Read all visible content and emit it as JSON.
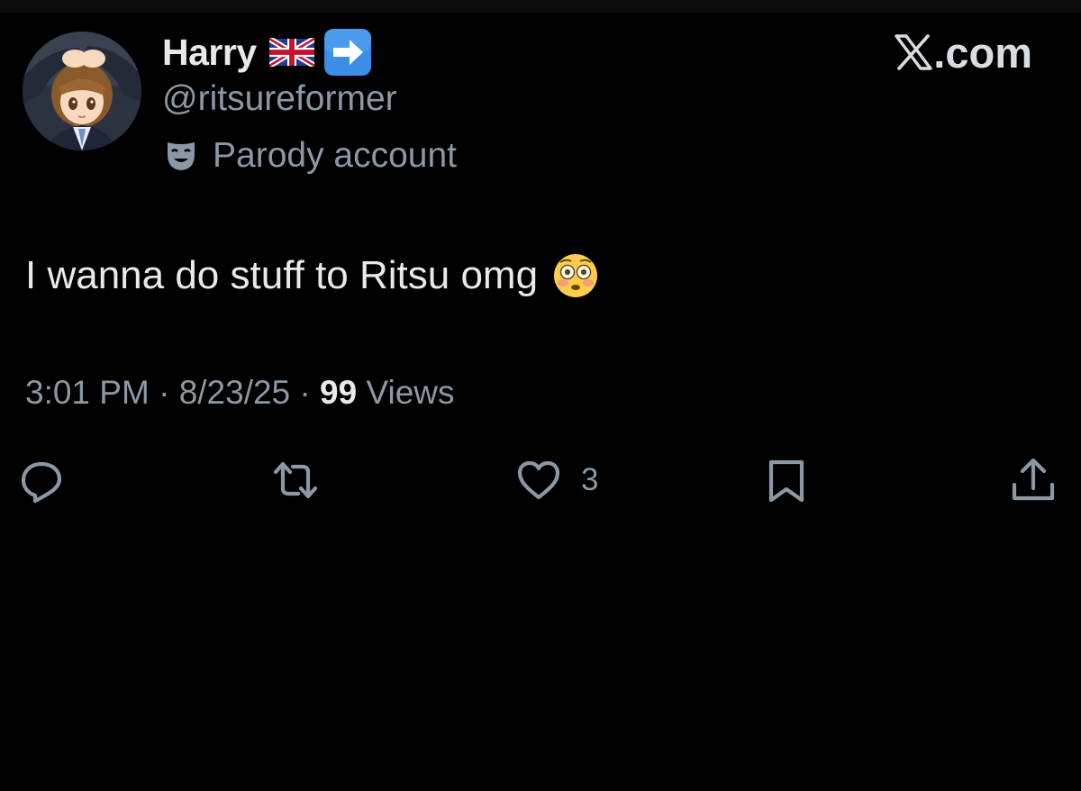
{
  "author": {
    "display_name": "Harry",
    "handle": "@ritsureformer",
    "label": "Parody account"
  },
  "brand": {
    "text": ".com"
  },
  "tweet": {
    "text": "I wanna do stuff to Ritsu omg"
  },
  "meta": {
    "time": "3:01 PM",
    "separator1": " · ",
    "date": "8/23/25",
    "separator2": " · ",
    "views_count": "99",
    "views_label": " Views"
  },
  "actions": {
    "like_count": "3"
  },
  "icons": {
    "avatar": "avatar-image",
    "flag": "union-jack-flag-icon",
    "badge": "right-arrow-icon",
    "label": "theater-mask-icon",
    "emoji": "flushed-face-emoji",
    "reply": "reply-icon",
    "repost": "repost-icon",
    "like": "heart-icon",
    "bookmark": "bookmark-icon",
    "share": "share-icon"
  },
  "colors": {
    "background": "#000000",
    "primary_text": "#e7e9ea",
    "secondary_text": "#8b98a5",
    "badge_blue": "#3b8ee8"
  }
}
